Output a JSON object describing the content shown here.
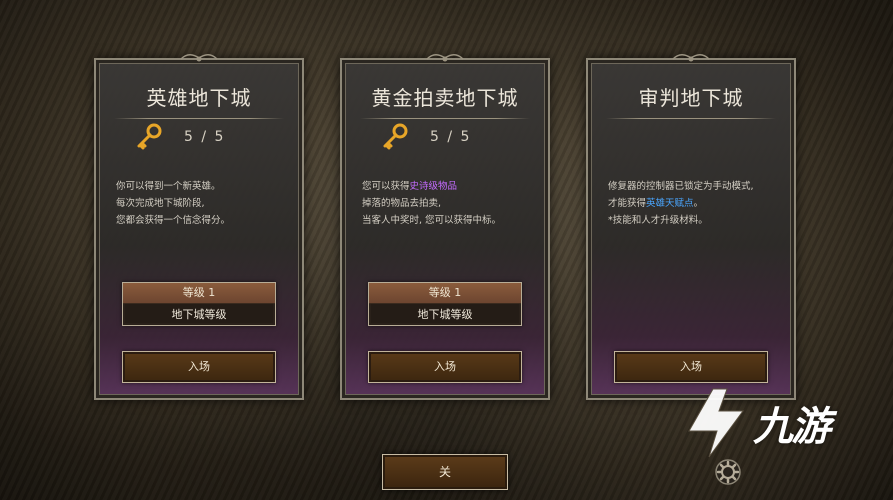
{
  "dungeons": [
    {
      "title": "英雄地下城",
      "key_count": "5 / 5",
      "desc": [
        [
          {
            "t": "你可以得到一个新英雄。",
            "c": ""
          }
        ],
        [
          {
            "t": "每次完成地下城阶段,",
            "c": ""
          }
        ],
        [
          {
            "t": "您都会获得一个信念得分。",
            "c": ""
          }
        ]
      ],
      "level_label": "等级 1",
      "level_title": "地下城等级",
      "enter_label": "入场"
    },
    {
      "title": "黄金拍卖地下城",
      "key_count": "5 / 5",
      "desc": [
        [
          {
            "t": "您可以获得",
            "c": ""
          },
          {
            "t": "史诗级物品",
            "c": "purple"
          }
        ],
        [
          {
            "t": "掉落的物品去拍卖,",
            "c": ""
          }
        ],
        [
          {
            "t": "当客人中奖时, 您可以获得中标。",
            "c": ""
          }
        ]
      ],
      "level_label": "等级 1",
      "level_title": "地下城等级",
      "enter_label": "入场"
    },
    {
      "title": "审判地下城",
      "key_count": "",
      "desc": [
        [
          {
            "t": "修复器的控制器已锁定为手动模式,",
            "c": ""
          }
        ],
        [
          {
            "t": "才能获得",
            "c": ""
          },
          {
            "t": "英雄天赋点",
            "c": "blue"
          },
          {
            "t": "。",
            "c": ""
          }
        ],
        [
          {
            "t": "*技能和人才升级材料。",
            "c": ""
          }
        ]
      ],
      "level_label": "",
      "level_title": "",
      "enter_label": "入场"
    }
  ],
  "close_label": "关",
  "watermark_text": "九游",
  "colors": {
    "purple_highlight": "#c46bff",
    "blue_highlight": "#4aa6ff",
    "key_gold": "#e8a628"
  },
  "icons": {
    "key": "key-icon",
    "settings": "gear-icon",
    "logo": "jiuyou-logo-icon",
    "ornament": "ornament-icon"
  }
}
